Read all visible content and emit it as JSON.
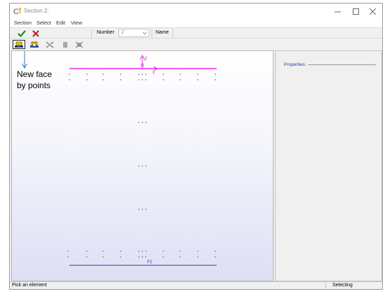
{
  "window": {
    "title": "Section 2:"
  },
  "menu": {
    "items": [
      "Section",
      "Select",
      "Edit",
      "View"
    ]
  },
  "toolbar": {
    "number_label": "Number",
    "number_value": "2",
    "name_label": "Name"
  },
  "canvas": {
    "axis_z": "Z",
    "axis_y": "Y",
    "label_f2": "F2"
  },
  "annotation": {
    "line1": "New face",
    "line2": "by points"
  },
  "properties": {
    "label": "Properties:"
  },
  "status": {
    "left": "Pick an element",
    "right": "Selecting"
  },
  "colors": {
    "accent": "#e000e0",
    "canvas_bottom": "#dedff4",
    "check": "#1a8a1a",
    "cross": "#c01818"
  }
}
